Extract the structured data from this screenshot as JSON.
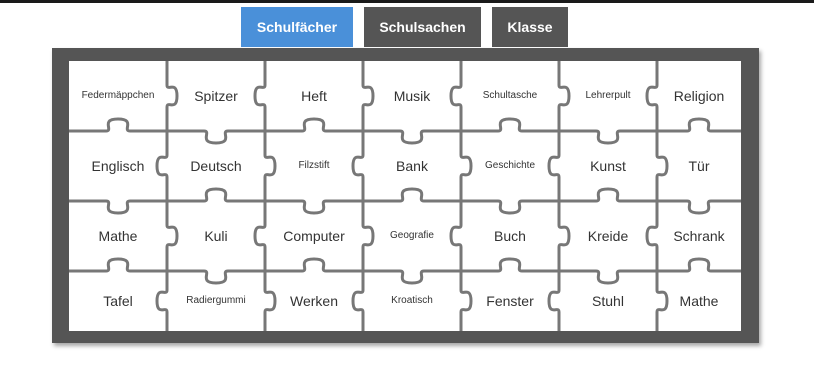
{
  "tabs": [
    {
      "label": "Schulfächer",
      "active": true
    },
    {
      "label": "Schulsachen",
      "active": false
    },
    {
      "label": "Klasse",
      "active": false
    }
  ],
  "pieces": [
    [
      {
        "text": "Federmäppchen",
        "size": "small"
      },
      {
        "text": "Spitzer",
        "size": "normal"
      },
      {
        "text": "Heft",
        "size": "normal"
      },
      {
        "text": "Musik",
        "size": "normal"
      },
      {
        "text": "Schultasche",
        "size": "small"
      },
      {
        "text": "Lehrerpult",
        "size": "small"
      },
      {
        "text": "Religion",
        "size": "normal"
      }
    ],
    [
      {
        "text": "Englisch",
        "size": "normal"
      },
      {
        "text": "Deutsch",
        "size": "normal"
      },
      {
        "text": "Filzstift",
        "size": "small"
      },
      {
        "text": "Bank",
        "size": "normal"
      },
      {
        "text": "Geschichte",
        "size": "small"
      },
      {
        "text": "Kunst",
        "size": "normal"
      },
      {
        "text": "Tür",
        "size": "normal"
      }
    ],
    [
      {
        "text": "Mathe",
        "size": "normal"
      },
      {
        "text": "Kuli",
        "size": "normal"
      },
      {
        "text": "Computer",
        "size": "normal"
      },
      {
        "text": "Geografie",
        "size": "small"
      },
      {
        "text": "Buch",
        "size": "normal"
      },
      {
        "text": "Kreide",
        "size": "normal"
      },
      {
        "text": "Schrank",
        "size": "normal"
      }
    ],
    [
      {
        "text": "Tafel",
        "size": "normal"
      },
      {
        "text": "Radiergummi",
        "size": "small"
      },
      {
        "text": "Werken",
        "size": "normal"
      },
      {
        "text": "Kroatisch",
        "size": "small"
      },
      {
        "text": "Fenster",
        "size": "normal"
      },
      {
        "text": "Stuhl",
        "size": "normal"
      },
      {
        "text": "Mathe",
        "size": "normal"
      }
    ]
  ],
  "colors": {
    "active_tab": "#4a90d9",
    "inactive_tab": "#555555",
    "board": "#555555",
    "piece_line": "#777777"
  }
}
